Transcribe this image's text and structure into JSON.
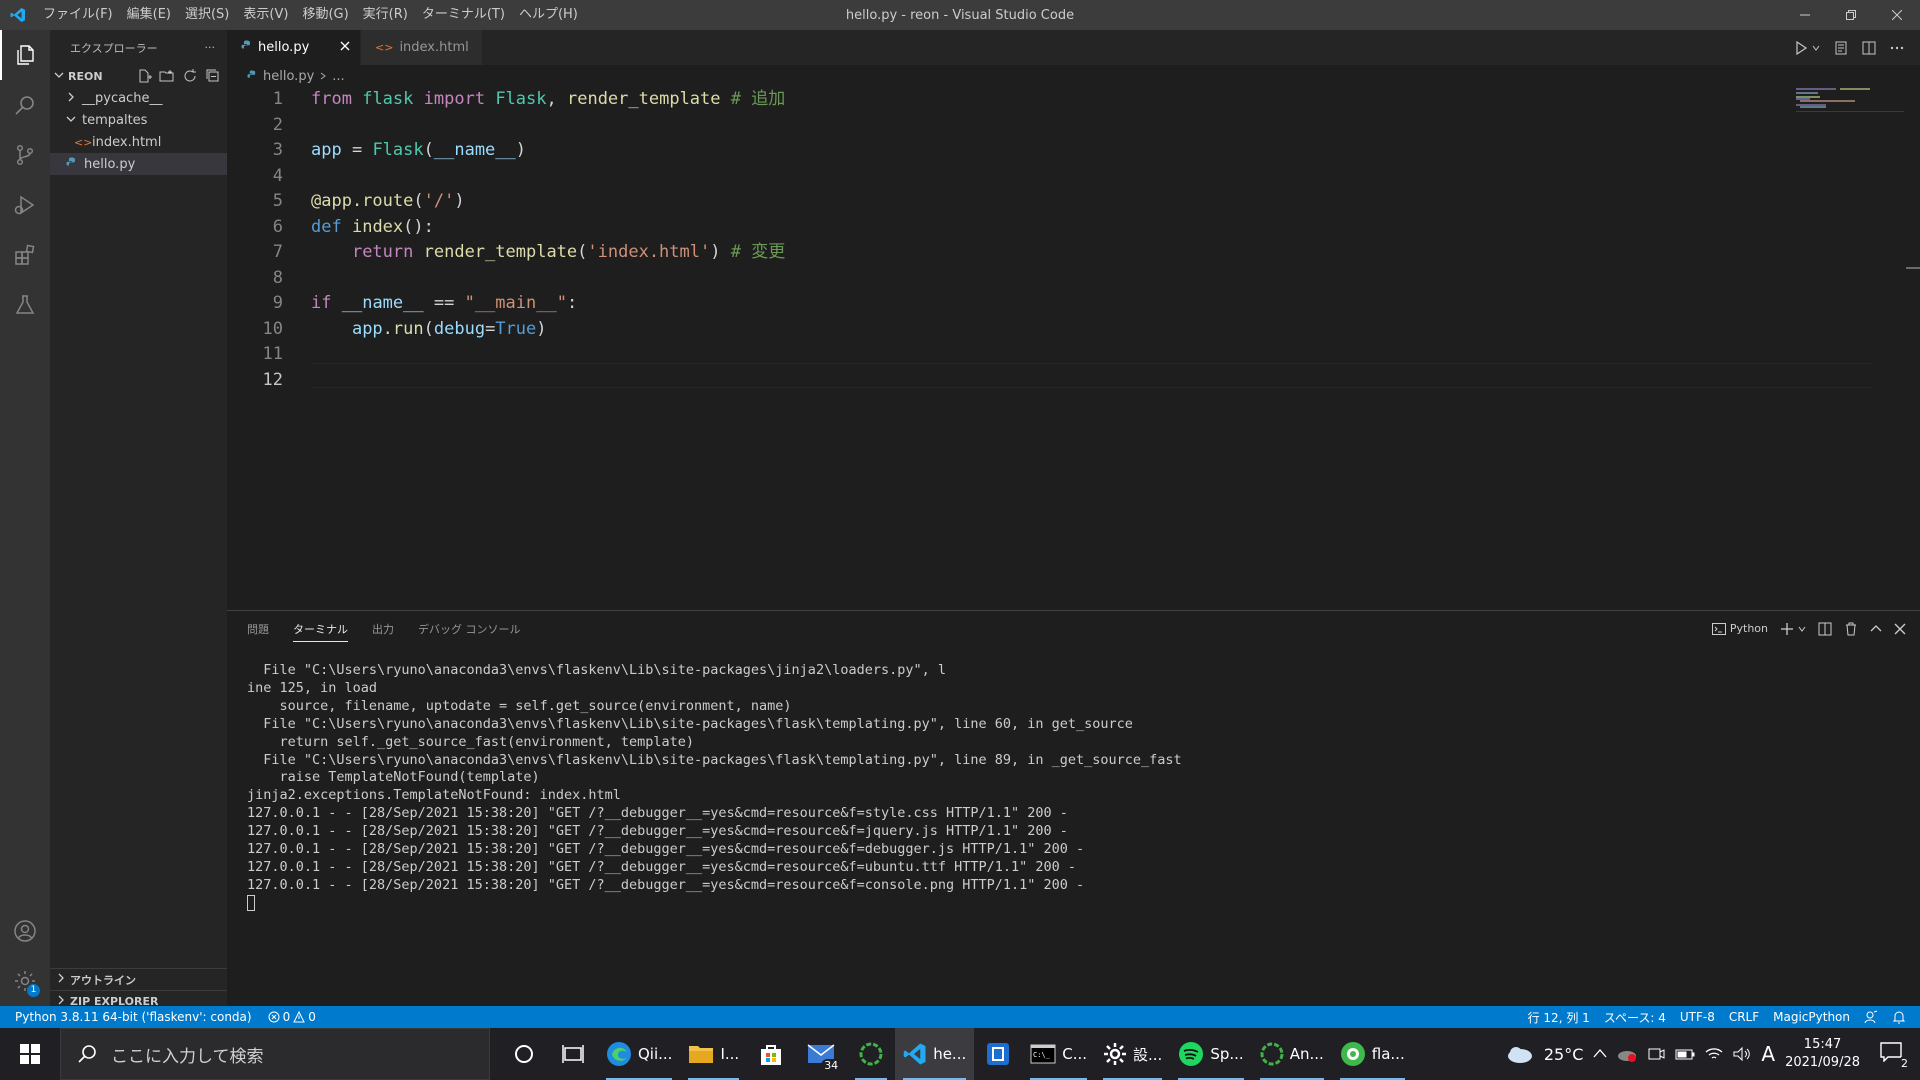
{
  "window": {
    "title": "hello.py - reon - Visual Studio Code",
    "menu": [
      "ファイル(F)",
      "編集(E)",
      "選択(S)",
      "表示(V)",
      "移動(G)",
      "実行(R)",
      "ターミナル(T)",
      "ヘルプ(H)"
    ]
  },
  "sidebar": {
    "title": "エクスプローラー",
    "more": "···",
    "root": "REON",
    "items": [
      {
        "label": "__pycache__"
      },
      {
        "label": "tempaltes"
      },
      {
        "label": "index.html"
      },
      {
        "label": "hello.py"
      }
    ],
    "outline": "アウトライン",
    "zip": "ZIP EXPLORER"
  },
  "tabs": [
    {
      "label": "hello.py"
    },
    {
      "label": "index.html"
    }
  ],
  "breadcrumb": {
    "file": "hello.py",
    "rest": "..."
  },
  "editor": {
    "line_numbers": [
      "1",
      "2",
      "3",
      "4",
      "5",
      "6",
      "7",
      "8",
      "9",
      "10",
      "11",
      "12"
    ],
    "lines": [
      [
        {
          "t": "from",
          "c": "kw-ctrl"
        },
        {
          "t": " "
        },
        {
          "t": "flask",
          "c": "cls"
        },
        {
          "t": " "
        },
        {
          "t": "import",
          "c": "kw-ctrl"
        },
        {
          "t": " "
        },
        {
          "t": "Flask",
          "c": "cls"
        },
        {
          "t": ", "
        },
        {
          "t": "render_template",
          "c": "fn"
        },
        {
          "t": " "
        },
        {
          "t": "# 追加",
          "c": "cmt"
        }
      ],
      [],
      [
        {
          "t": "app",
          "c": "var"
        },
        {
          "t": " = "
        },
        {
          "t": "Flask",
          "c": "cls"
        },
        {
          "t": "("
        },
        {
          "t": "__name__",
          "c": "var"
        },
        {
          "t": ")"
        }
      ],
      [],
      [
        {
          "t": "@app.route",
          "c": "fn"
        },
        {
          "t": "("
        },
        {
          "t": "'/'",
          "c": "str"
        },
        {
          "t": ")"
        }
      ],
      [
        {
          "t": "def",
          "c": "kw"
        },
        {
          "t": " "
        },
        {
          "t": "index",
          "c": "fn"
        },
        {
          "t": "():"
        }
      ],
      [
        {
          "t": "    "
        },
        {
          "t": "return",
          "c": "kw-ctrl"
        },
        {
          "t": " "
        },
        {
          "t": "render_template",
          "c": "fn"
        },
        {
          "t": "("
        },
        {
          "t": "'index.html'",
          "c": "str"
        },
        {
          "t": ") "
        },
        {
          "t": "# 変更",
          "c": "cmt"
        }
      ],
      [],
      [
        {
          "t": "if",
          "c": "kw-ctrl"
        },
        {
          "t": " "
        },
        {
          "t": "__name__",
          "c": "var"
        },
        {
          "t": " == "
        },
        {
          "t": "\"__main__\"",
          "c": "str"
        },
        {
          "t": ":"
        }
      ],
      [
        {
          "t": "    "
        },
        {
          "t": "app",
          "c": "var"
        },
        {
          "t": "."
        },
        {
          "t": "run",
          "c": "fn"
        },
        {
          "t": "("
        },
        {
          "t": "debug",
          "c": "var"
        },
        {
          "t": "="
        },
        {
          "t": "True",
          "c": "kw"
        },
        {
          "t": ")"
        }
      ],
      [],
      []
    ]
  },
  "panel": {
    "tabs": [
      "問題",
      "ターミナル",
      "出力",
      "デバッグ コンソール"
    ],
    "shell": "Python",
    "terminal_lines": [
      "  File \"C:\\Users\\ryuno\\anaconda3\\envs\\flaskenv\\Lib\\site-packages\\jinja2\\loaders.py\", l",
      "ine 125, in load",
      "    source, filename, uptodate = self.get_source(environment, name)",
      "  File \"C:\\Users\\ryuno\\anaconda3\\envs\\flaskenv\\Lib\\site-packages\\flask\\templating.py\", line 60, in get_source",
      "    return self._get_source_fast(environment, template)",
      "  File \"C:\\Users\\ryuno\\anaconda3\\envs\\flaskenv\\Lib\\site-packages\\flask\\templating.py\", line 89, in _get_source_fast",
      "    raise TemplateNotFound(template)",
      "jinja2.exceptions.TemplateNotFound: index.html",
      "127.0.0.1 - - [28/Sep/2021 15:38:20] \"GET /?__debugger__=yes&cmd=resource&f=style.css HTTP/1.1\" 200 -",
      "127.0.0.1 - - [28/Sep/2021 15:38:20] \"GET /?__debugger__=yes&cmd=resource&f=jquery.js HTTP/1.1\" 200 -",
      "127.0.0.1 - - [28/Sep/2021 15:38:20] \"GET /?__debugger__=yes&cmd=resource&f=debugger.js HTTP/1.1\" 200 -",
      "127.0.0.1 - - [28/Sep/2021 15:38:20] \"GET /?__debugger__=yes&cmd=resource&f=ubuntu.ttf HTTP/1.1\" 200 -",
      "127.0.0.1 - - [28/Sep/2021 15:38:20] \"GET /?__debugger__=yes&cmd=resource&f=console.png HTTP/1.1\" 200 -"
    ]
  },
  "statusbar": {
    "interpreter": "Python 3.8.11 64-bit ('flaskenv': conda)",
    "errors": "0",
    "warnings": "0",
    "position": "行 12, 列 1",
    "spaces": "スペース: 4",
    "encoding": "UTF-8",
    "eol": "CRLF",
    "language": "MagicPython"
  },
  "taskbar": {
    "search_placeholder": "ここに入力して検索",
    "apps": [
      {
        "label": "Qii...",
        "icon": "edge-icon"
      },
      {
        "label": "I...",
        "icon": "folder-icon"
      },
      {
        "label": "",
        "icon": "store-icon"
      },
      {
        "label": "",
        "icon": "mail-icon",
        "badge": "34"
      },
      {
        "label": "",
        "icon": "anaconda-icon"
      },
      {
        "label": "he...",
        "icon": "vscode-icon"
      },
      {
        "label": "",
        "icon": "snipping-icon"
      },
      {
        "label": "C...",
        "icon": "cmd-icon"
      },
      {
        "label": "設...",
        "icon": "settings-icon"
      },
      {
        "label": "Sp...",
        "icon": "spotify-icon"
      },
      {
        "label": "An...",
        "icon": "anaconda-icon"
      },
      {
        "label": "fla...",
        "icon": "flask-app-icon"
      }
    ],
    "weather": "25°C",
    "ime": "A",
    "time": "15:47",
    "date": "2021/09/28",
    "notifications": "2"
  },
  "colors": {
    "accent": "#007acc",
    "activity": "#333333",
    "sidebar": "#252526",
    "editor": "#1e1e1e"
  }
}
